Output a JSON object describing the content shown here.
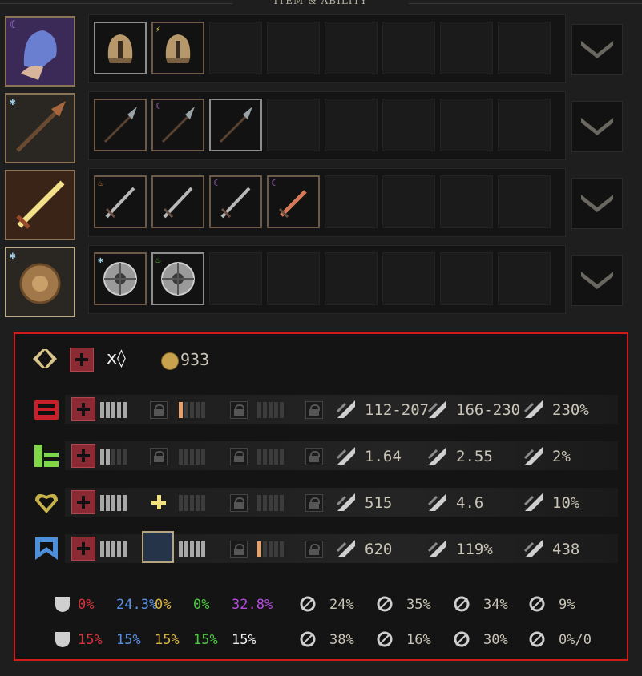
{
  "section_title": "ITEM & ABILITY",
  "colors": {
    "frame_red": "#d11c1c",
    "bronze": "#8a7357",
    "red_box": "#8c2a33"
  },
  "equipment_rows": [
    {
      "name": "helmet",
      "icon": "hand-with-hooded-helmet-icon",
      "icon_gem": "moon",
      "items": [
        {
          "icon": "helmet-icon",
          "gem": ""
        },
        {
          "icon": "helmet-icon",
          "gem": "lightning"
        }
      ]
    },
    {
      "name": "spear",
      "icon": "spear-head-icon",
      "icon_gem": "snowflake",
      "items": [
        {
          "icon": "spear-icon",
          "gem": ""
        },
        {
          "icon": "spear-icon",
          "gem": "moon"
        },
        {
          "icon": "spear-icon",
          "gem": ""
        }
      ]
    },
    {
      "name": "sword",
      "icon": "glowing-sword-icon",
      "icon_gem": "",
      "items": [
        {
          "icon": "sword-icon",
          "gem": "fire"
        },
        {
          "icon": "sword-icon",
          "gem": ""
        },
        {
          "icon": "sword-icon",
          "gem": "moon"
        },
        {
          "icon": "dagger-icon",
          "gem": "moon"
        }
      ]
    },
    {
      "name": "shield",
      "icon": "round-shield-icon",
      "icon_gem": "snowflake",
      "items": [
        {
          "icon": "buckler-icon",
          "gem": "snowflake"
        },
        {
          "icon": "buckler-icon",
          "gem": "flame-green"
        }
      ]
    }
  ],
  "summary": {
    "multiplier": "x◊",
    "gold": "933"
  },
  "attributes": [
    {
      "name": "strength",
      "color": "#c8202a",
      "stats": [
        {
          "icon": "melee-damage-icon",
          "value": "112-207"
        },
        {
          "icon": "ranged-damage-icon",
          "value": "166-230"
        },
        {
          "icon": "critical-damage-icon",
          "value": "230%"
        }
      ]
    },
    {
      "name": "dexterity",
      "color": "#7fd646",
      "stats": [
        {
          "icon": "attack-speed-icon",
          "value": "1.64"
        },
        {
          "icon": "double-strike-icon",
          "value": "2.55"
        },
        {
          "icon": "dodge-icon",
          "value": "2%"
        }
      ]
    },
    {
      "name": "vitality",
      "color": "#c8b24a",
      "stats": [
        {
          "icon": "health-icon",
          "value": "515"
        },
        {
          "icon": "health-regen-icon",
          "value": "4.6"
        },
        {
          "icon": "cooldown-hourglass-icon",
          "value": "10%"
        }
      ]
    },
    {
      "name": "defense",
      "color": "#4d8fd8",
      "stats": [
        {
          "icon": "armor-icon",
          "value": "620"
        },
        {
          "icon": "armor-boost-icon",
          "value": "119%"
        },
        {
          "icon": "armor-regen-icon",
          "value": "438"
        }
      ]
    }
  ],
  "resistances": {
    "row1": {
      "values": [
        {
          "value": "0%",
          "color": "#d8333f"
        },
        {
          "value": "24.3%",
          "color": "#5a8fe0"
        },
        {
          "value": "0%",
          "color": "#d8b840"
        },
        {
          "value": "0%",
          "color": "#4cc840"
        },
        {
          "value": "32.8%",
          "color": "#b64ae0"
        }
      ],
      "extra": [
        {
          "icon": "block-shield-icon",
          "value": "24%"
        },
        {
          "icon": "heart-steal-icon",
          "value": "35%"
        },
        {
          "icon": "target-crosshair-icon",
          "value": "34%"
        },
        {
          "icon": "evasion-figure-icon",
          "value": "9%"
        }
      ]
    },
    "row2": {
      "values": [
        {
          "value": "15%",
          "color": "#d8333f"
        },
        {
          "value": "15%",
          "color": "#5a8fe0"
        },
        {
          "value": "15%",
          "color": "#d8b840"
        },
        {
          "value": "15%",
          "color": "#4cc840"
        },
        {
          "value": "15%",
          "color": "#eeeeee"
        }
      ],
      "extra": [
        {
          "icon": "shield-bash-icon",
          "value": "38%"
        },
        {
          "icon": "potion-icon",
          "value": "16%"
        },
        {
          "icon": "sword-parry-icon",
          "value": "30%"
        },
        {
          "icon": "spirit-figure-icon",
          "value": "0%/0"
        }
      ]
    }
  }
}
